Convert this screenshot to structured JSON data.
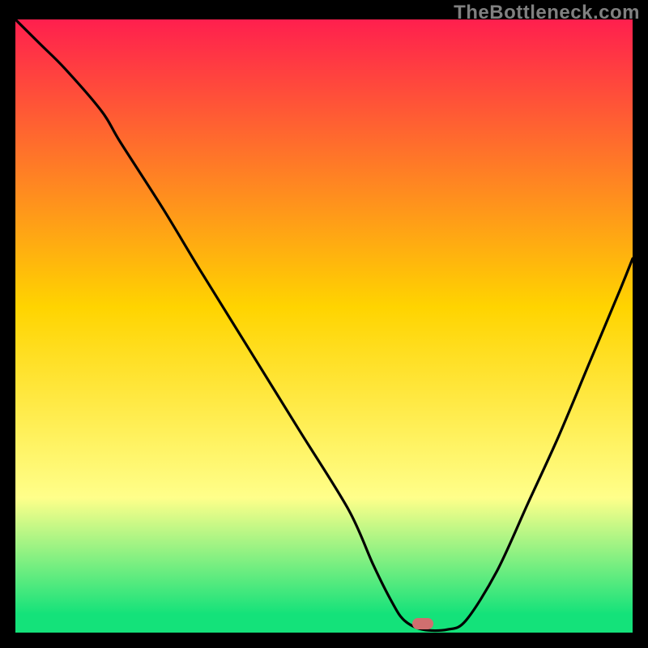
{
  "watermark": "TheBottleneck.com",
  "colors": {
    "frame": "#000000",
    "marker": "#cf6f6f",
    "curve": "#000000",
    "top": "#ff1f4e",
    "mid": "#ffd400",
    "low": "#ffff8a",
    "bottom": "#14e27a"
  },
  "chart_data": {
    "type": "line",
    "title": "",
    "xlabel": "",
    "ylabel": "",
    "x_range": [
      0,
      100
    ],
    "y_range": [
      0,
      100
    ],
    "note": "Values estimated from pixel positions relative to 762x757 plot area; x is percent across, y is percent of height from bottom.",
    "series": [
      {
        "name": "bottleneck-curve",
        "x": [
          0,
          4,
          8,
          14,
          17,
          24,
          30,
          38,
          46,
          54,
          58,
          61,
          63,
          66,
          70,
          73,
          78,
          83,
          88,
          93,
          98,
          100
        ],
        "y": [
          100,
          96,
          92,
          85,
          80,
          69,
          59,
          46,
          33,
          20,
          11,
          5,
          2,
          0.5,
          0.5,
          2,
          10,
          21,
          32,
          44,
          56,
          61
        ]
      }
    ],
    "marker": {
      "x": 66,
      "y": 1.5,
      "shape": "rounded-rect"
    },
    "gradient_stops": [
      {
        "pct": 0,
        "color_key": "top"
      },
      {
        "pct": 47,
        "color_key": "mid"
      },
      {
        "pct": 78,
        "color_key": "low"
      },
      {
        "pct": 97,
        "color_key": "bottom"
      },
      {
        "pct": 100,
        "color_key": "bottom"
      }
    ]
  }
}
